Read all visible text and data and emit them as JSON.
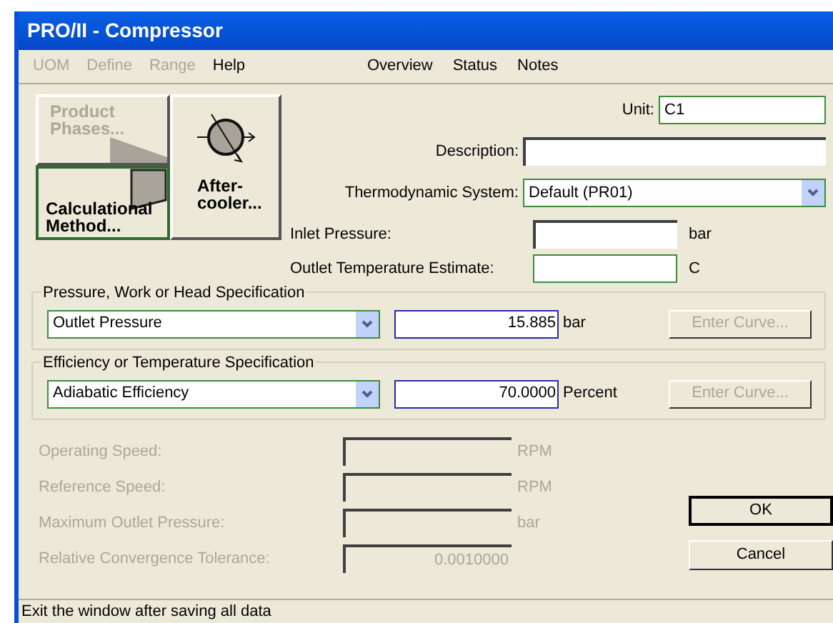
{
  "window": {
    "title": "PRO/II - Compressor"
  },
  "menu": [
    {
      "label": "UOM",
      "disabled": true
    },
    {
      "label": "Define",
      "disabled": true
    },
    {
      "label": "Range",
      "disabled": true
    },
    {
      "label": "Help",
      "disabled": false
    }
  ],
  "links": [
    "Overview",
    "Status",
    "Notes"
  ],
  "icon_buttons": [
    {
      "label": "Product Phases...",
      "disabled": true,
      "selected": false
    },
    {
      "label": "Calculational Method...",
      "disabled": false,
      "selected": true
    },
    {
      "label": "After-cooler...",
      "disabled": false,
      "selected": false
    }
  ],
  "unit": {
    "label": "Unit:",
    "value": "C1"
  },
  "description": {
    "label": "Description:"
  },
  "thermodynamic_system": {
    "label": "Thermodynamic System:",
    "value": "Default (PR01)"
  },
  "inlet_pressure": {
    "label": "Inlet Pressure:",
    "unit": "bar"
  },
  "outlet_temperature_estimate": {
    "label": "Outlet Temperature Estimate:",
    "unit": "C"
  },
  "specifications": [
    {
      "title": "Pressure, Work or Head Specification",
      "option": "Outlet Pressure",
      "value": "15.885",
      "unit": "bar",
      "button": {
        "label": "Enter Curve...",
        "disabled": true
      }
    },
    {
      "title": "Efficiency or Temperature Specification",
      "option": "Adiabatic Efficiency",
      "value": "70.0000",
      "unit": "Percent",
      "button": {
        "label": "Enter Curve...",
        "disabled": true
      }
    }
  ],
  "limits": [
    {
      "label": "Operating Speed:",
      "unit": "RPM",
      "disabled": true
    },
    {
      "label": "Reference Speed:",
      "unit": "RPM",
      "disabled": true
    },
    {
      "label": "Maximum Outlet Pressure:",
      "unit": "bar",
      "disabled": true
    },
    {
      "label": "Relative Convergence Tolerance:",
      "value": "0.0010000",
      "disabled": true
    }
  ],
  "buttons": [
    {
      "label": "OK",
      "default": true
    },
    {
      "label": "Cancel",
      "default": false
    }
  ],
  "status_bar": "Exit the window after saving all data"
}
